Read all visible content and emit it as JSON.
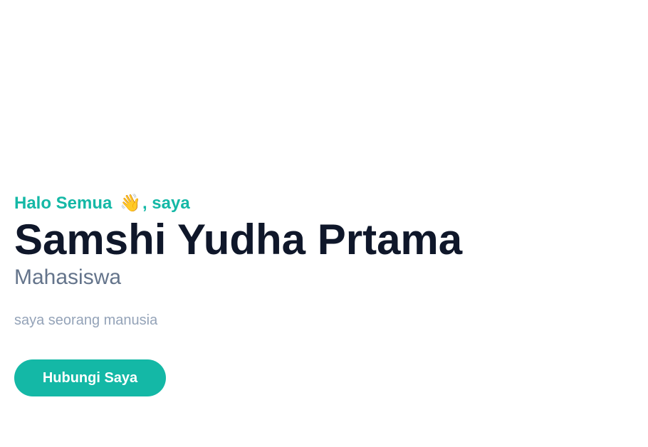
{
  "hero": {
    "greeting_prefix": "Halo Semua",
    "greeting_icon": "👋",
    "greeting_suffix": ", saya",
    "name": "Samshi Yudha Prtama",
    "role": "Mahasiswa",
    "description": "saya seorang manusia",
    "cta_label": "Hubungi Saya"
  },
  "colors": {
    "accent": "#14b8a6",
    "name": "#0f172a",
    "role": "#64748b",
    "description": "#94a3b8"
  },
  "icons": {
    "greeting": "waving-hand-icon"
  }
}
